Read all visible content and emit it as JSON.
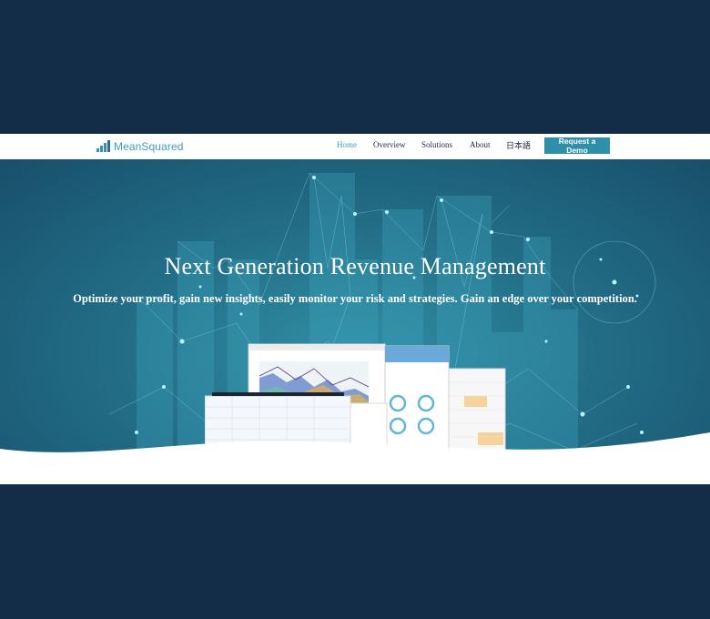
{
  "brand": {
    "name": "MeanSquared",
    "accent": "#3e9ec0"
  },
  "nav": {
    "items": [
      {
        "label": "Home",
        "active": true
      },
      {
        "label": "Overview",
        "active": false
      },
      {
        "label": "Solutions",
        "active": false
      },
      {
        "label": "About",
        "active": false
      },
      {
        "label": "日本語",
        "active": false
      }
    ],
    "cta_label": "Request a Demo"
  },
  "hero": {
    "title": "Next Generation Revenue Management",
    "subtitle": "Optimize your profit, gain new insights, easily monitor your risk and strategies. Gain an edge over your competition."
  },
  "colors": {
    "page_bg": "#132c47",
    "header_bg": "#ffffff",
    "cta_bg": "#2e8fa9",
    "hero_bg": "#236f88"
  }
}
